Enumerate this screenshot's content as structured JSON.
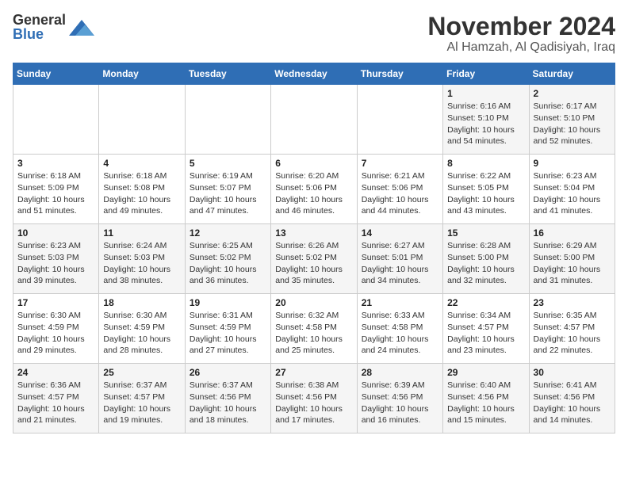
{
  "logo": {
    "general": "General",
    "blue": "Blue"
  },
  "title": "November 2024",
  "subtitle": "Al Hamzah, Al Qadisiyah, Iraq",
  "headers": [
    "Sunday",
    "Monday",
    "Tuesday",
    "Wednesday",
    "Thursday",
    "Friday",
    "Saturday"
  ],
  "weeks": [
    [
      {
        "day": "",
        "text": ""
      },
      {
        "day": "",
        "text": ""
      },
      {
        "day": "",
        "text": ""
      },
      {
        "day": "",
        "text": ""
      },
      {
        "day": "",
        "text": ""
      },
      {
        "day": "1",
        "text": "Sunrise: 6:16 AM\nSunset: 5:10 PM\nDaylight: 10 hours and 54 minutes."
      },
      {
        "day": "2",
        "text": "Sunrise: 6:17 AM\nSunset: 5:10 PM\nDaylight: 10 hours and 52 minutes."
      }
    ],
    [
      {
        "day": "3",
        "text": "Sunrise: 6:18 AM\nSunset: 5:09 PM\nDaylight: 10 hours and 51 minutes."
      },
      {
        "day": "4",
        "text": "Sunrise: 6:18 AM\nSunset: 5:08 PM\nDaylight: 10 hours and 49 minutes."
      },
      {
        "day": "5",
        "text": "Sunrise: 6:19 AM\nSunset: 5:07 PM\nDaylight: 10 hours and 47 minutes."
      },
      {
        "day": "6",
        "text": "Sunrise: 6:20 AM\nSunset: 5:06 PM\nDaylight: 10 hours and 46 minutes."
      },
      {
        "day": "7",
        "text": "Sunrise: 6:21 AM\nSunset: 5:06 PM\nDaylight: 10 hours and 44 minutes."
      },
      {
        "day": "8",
        "text": "Sunrise: 6:22 AM\nSunset: 5:05 PM\nDaylight: 10 hours and 43 minutes."
      },
      {
        "day": "9",
        "text": "Sunrise: 6:23 AM\nSunset: 5:04 PM\nDaylight: 10 hours and 41 minutes."
      }
    ],
    [
      {
        "day": "10",
        "text": "Sunrise: 6:23 AM\nSunset: 5:03 PM\nDaylight: 10 hours and 39 minutes."
      },
      {
        "day": "11",
        "text": "Sunrise: 6:24 AM\nSunset: 5:03 PM\nDaylight: 10 hours and 38 minutes."
      },
      {
        "day": "12",
        "text": "Sunrise: 6:25 AM\nSunset: 5:02 PM\nDaylight: 10 hours and 36 minutes."
      },
      {
        "day": "13",
        "text": "Sunrise: 6:26 AM\nSunset: 5:02 PM\nDaylight: 10 hours and 35 minutes."
      },
      {
        "day": "14",
        "text": "Sunrise: 6:27 AM\nSunset: 5:01 PM\nDaylight: 10 hours and 34 minutes."
      },
      {
        "day": "15",
        "text": "Sunrise: 6:28 AM\nSunset: 5:00 PM\nDaylight: 10 hours and 32 minutes."
      },
      {
        "day": "16",
        "text": "Sunrise: 6:29 AM\nSunset: 5:00 PM\nDaylight: 10 hours and 31 minutes."
      }
    ],
    [
      {
        "day": "17",
        "text": "Sunrise: 6:30 AM\nSunset: 4:59 PM\nDaylight: 10 hours and 29 minutes."
      },
      {
        "day": "18",
        "text": "Sunrise: 6:30 AM\nSunset: 4:59 PM\nDaylight: 10 hours and 28 minutes."
      },
      {
        "day": "19",
        "text": "Sunrise: 6:31 AM\nSunset: 4:59 PM\nDaylight: 10 hours and 27 minutes."
      },
      {
        "day": "20",
        "text": "Sunrise: 6:32 AM\nSunset: 4:58 PM\nDaylight: 10 hours and 25 minutes."
      },
      {
        "day": "21",
        "text": "Sunrise: 6:33 AM\nSunset: 4:58 PM\nDaylight: 10 hours and 24 minutes."
      },
      {
        "day": "22",
        "text": "Sunrise: 6:34 AM\nSunset: 4:57 PM\nDaylight: 10 hours and 23 minutes."
      },
      {
        "day": "23",
        "text": "Sunrise: 6:35 AM\nSunset: 4:57 PM\nDaylight: 10 hours and 22 minutes."
      }
    ],
    [
      {
        "day": "24",
        "text": "Sunrise: 6:36 AM\nSunset: 4:57 PM\nDaylight: 10 hours and 21 minutes."
      },
      {
        "day": "25",
        "text": "Sunrise: 6:37 AM\nSunset: 4:57 PM\nDaylight: 10 hours and 19 minutes."
      },
      {
        "day": "26",
        "text": "Sunrise: 6:37 AM\nSunset: 4:56 PM\nDaylight: 10 hours and 18 minutes."
      },
      {
        "day": "27",
        "text": "Sunrise: 6:38 AM\nSunset: 4:56 PM\nDaylight: 10 hours and 17 minutes."
      },
      {
        "day": "28",
        "text": "Sunrise: 6:39 AM\nSunset: 4:56 PM\nDaylight: 10 hours and 16 minutes."
      },
      {
        "day": "29",
        "text": "Sunrise: 6:40 AM\nSunset: 4:56 PM\nDaylight: 10 hours and 15 minutes."
      },
      {
        "day": "30",
        "text": "Sunrise: 6:41 AM\nSunset: 4:56 PM\nDaylight: 10 hours and 14 minutes."
      }
    ]
  ]
}
